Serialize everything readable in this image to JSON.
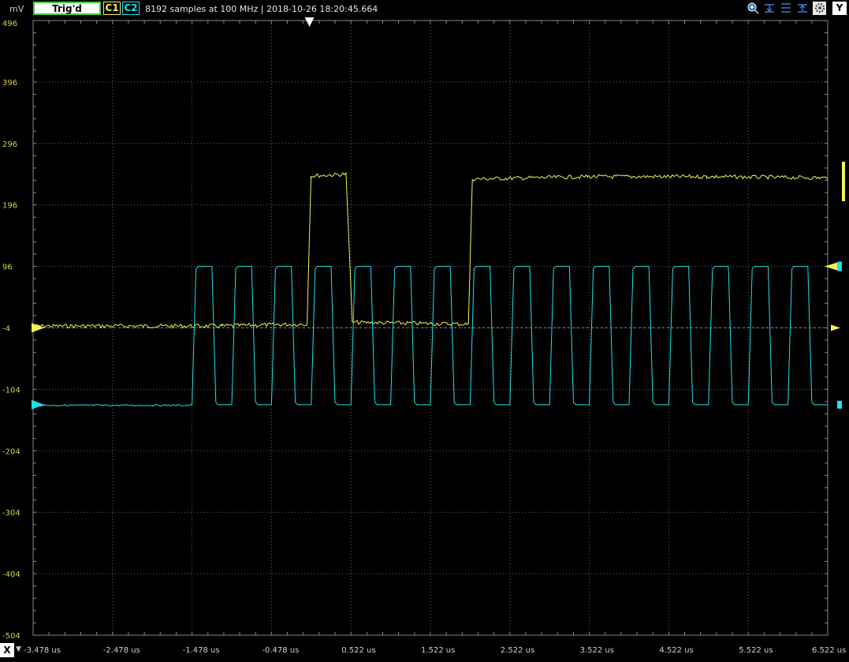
{
  "toolbar": {
    "unit_label": "mV",
    "trigger_status": "Trig'd",
    "channel1_label": "C1",
    "channel2_label": "C2",
    "acquisition_info": "8192 samples at 100 MHz | 2018-10-26 18:20:45.664",
    "y_axis_button": "Y",
    "icons": [
      "zoom-in-icon",
      "cursor-down-icon",
      "cursor-align-icon",
      "cursor-up-icon",
      "settings-icon"
    ]
  },
  "xaxis_controls": {
    "x_button": "X",
    "dropdown": "▼"
  },
  "chart_data": {
    "type": "line",
    "title": "",
    "xlabel": "",
    "ylabel": "mV",
    "xlim": [
      -3.478,
      6.522
    ],
    "ylim": [
      -504,
      496
    ],
    "x_ticks": [
      "-3.478 us",
      "-2.478 us",
      "-1.478 us",
      "-0.478 us",
      "0.522 us",
      "1.522 us",
      "2.522 us",
      "3.522 us",
      "4.522 us",
      "5.522 us",
      "6.522 us"
    ],
    "y_ticks": [
      "496",
      "396",
      "296",
      "196",
      "96",
      "-4",
      "-104",
      "-204",
      "-304",
      "-404",
      "-504"
    ],
    "grid": true,
    "trigger_time": 0,
    "series": [
      {
        "name": "C1",
        "color": "#f4f15a",
        "points": [
          [
            -3.478,
            -1
          ],
          [
            -1.1,
            -1
          ],
          [
            -0.5,
            1
          ],
          [
            -0.03,
            2
          ],
          [
            0.02,
            243
          ],
          [
            0.46,
            246
          ],
          [
            0.54,
            5
          ],
          [
            2.0,
            2
          ],
          [
            2.05,
            238
          ],
          [
            3.5,
            242
          ],
          [
            5.0,
            242
          ],
          [
            6.52,
            240
          ]
        ]
      },
      {
        "name": "C2",
        "color": "#1fe1e8",
        "x_start": -1.478,
        "period": 0.5,
        "duty": 0.5,
        "high": 96,
        "low": -129,
        "idle_level": -130
      }
    ]
  }
}
